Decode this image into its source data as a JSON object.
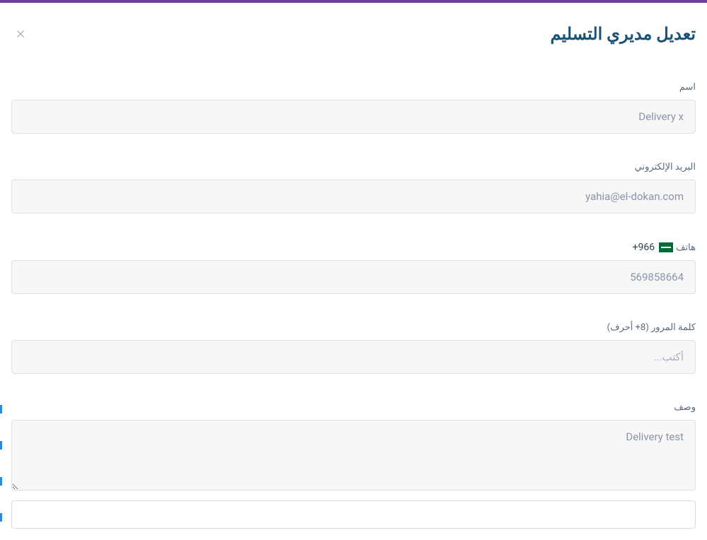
{
  "modal": {
    "title": "تعديل مديري التسليم",
    "fields": {
      "name": {
        "label": "اسم",
        "value": "Delivery x"
      },
      "email": {
        "label": "البريد الإلكتروني",
        "value": "yahia@el-dokan.com"
      },
      "phone": {
        "label": "هاتف",
        "country_code": "+966",
        "value": "569858664"
      },
      "password": {
        "label": "كلمة المرور (8+ أحرف)",
        "placeholder": "أكتب..."
      },
      "description": {
        "label": "وصف",
        "value": "Delivery test"
      }
    }
  }
}
